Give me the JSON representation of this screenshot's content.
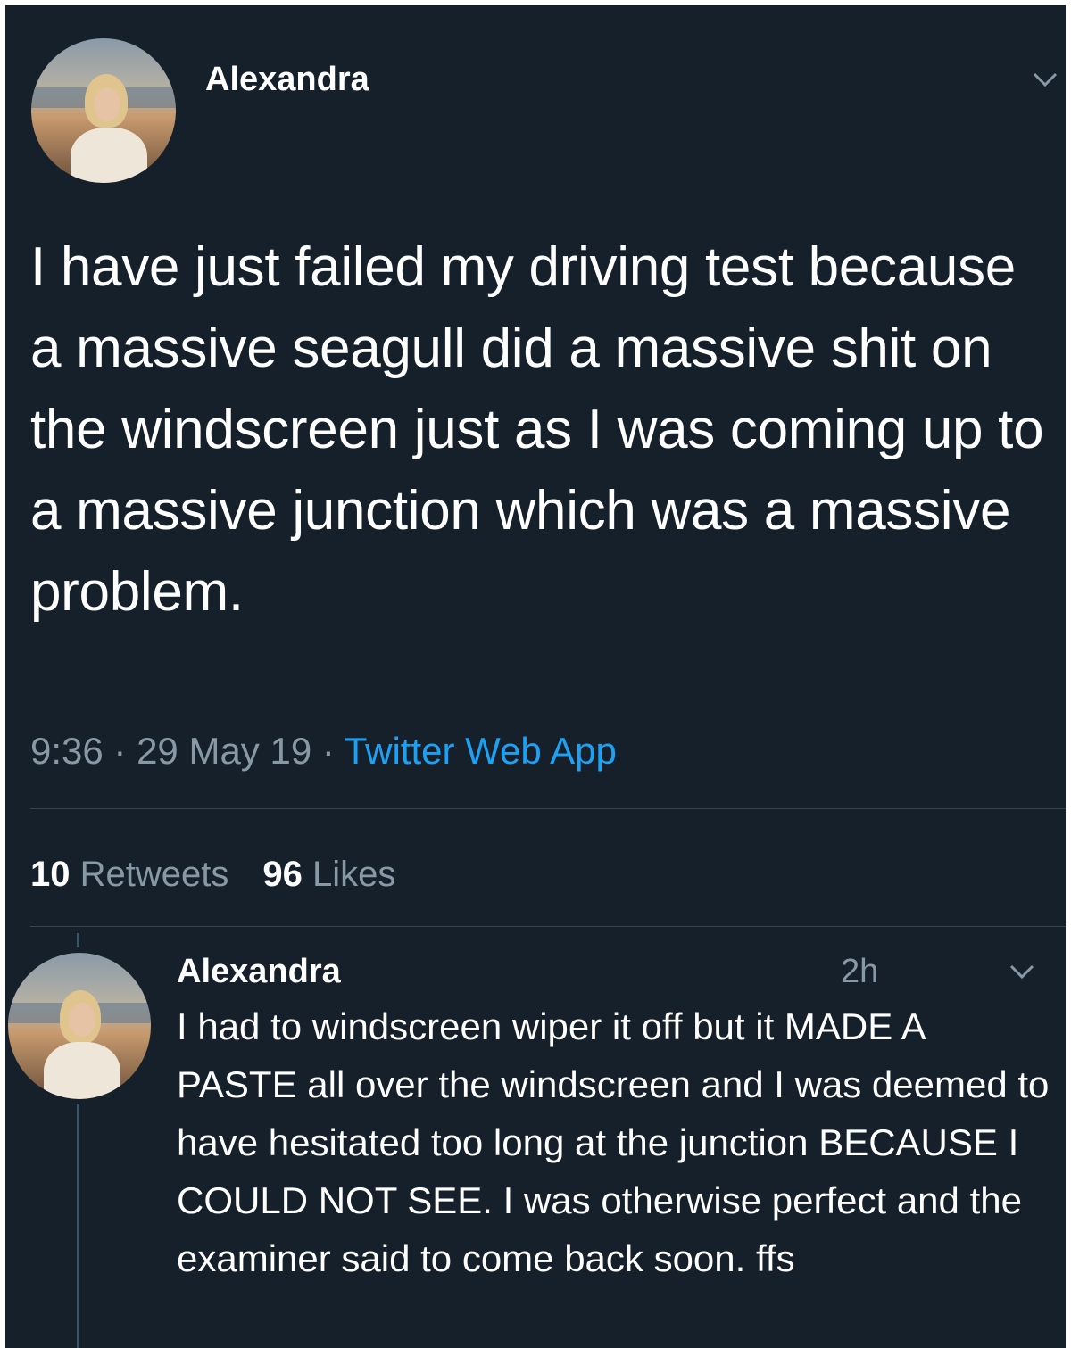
{
  "tweet": {
    "author_name": "Alexandra",
    "text": "I have just failed my driving test because a massive seagull did a massive shit on the windscreen just as I was coming up to a massive junction which was a massive problem.",
    "time": "9:36",
    "date": "29 May 19",
    "source": "Twitter Web App",
    "retweets_count": "10",
    "retweets_label": "Retweets",
    "likes_count": "96",
    "likes_label": "Likes",
    "menu_icon": "chevron-down-icon"
  },
  "reply": {
    "author_name": "Alexandra",
    "time_ago": "2h",
    "text": "I had to windscreen wiper it off but it MADE A PASTE all over the windscreen and I was deemed to have hesitated too long at the junction BECAUSE I COULD NOT SEE. I was otherwise perfect and the examiner said to come back soon. ffs",
    "menu_icon": "chevron-down-icon"
  },
  "colors": {
    "background": "#15202b",
    "text_primary": "#ffffff",
    "text_secondary": "#8899a6",
    "link": "#1da1f2",
    "divider": "#38444d"
  }
}
